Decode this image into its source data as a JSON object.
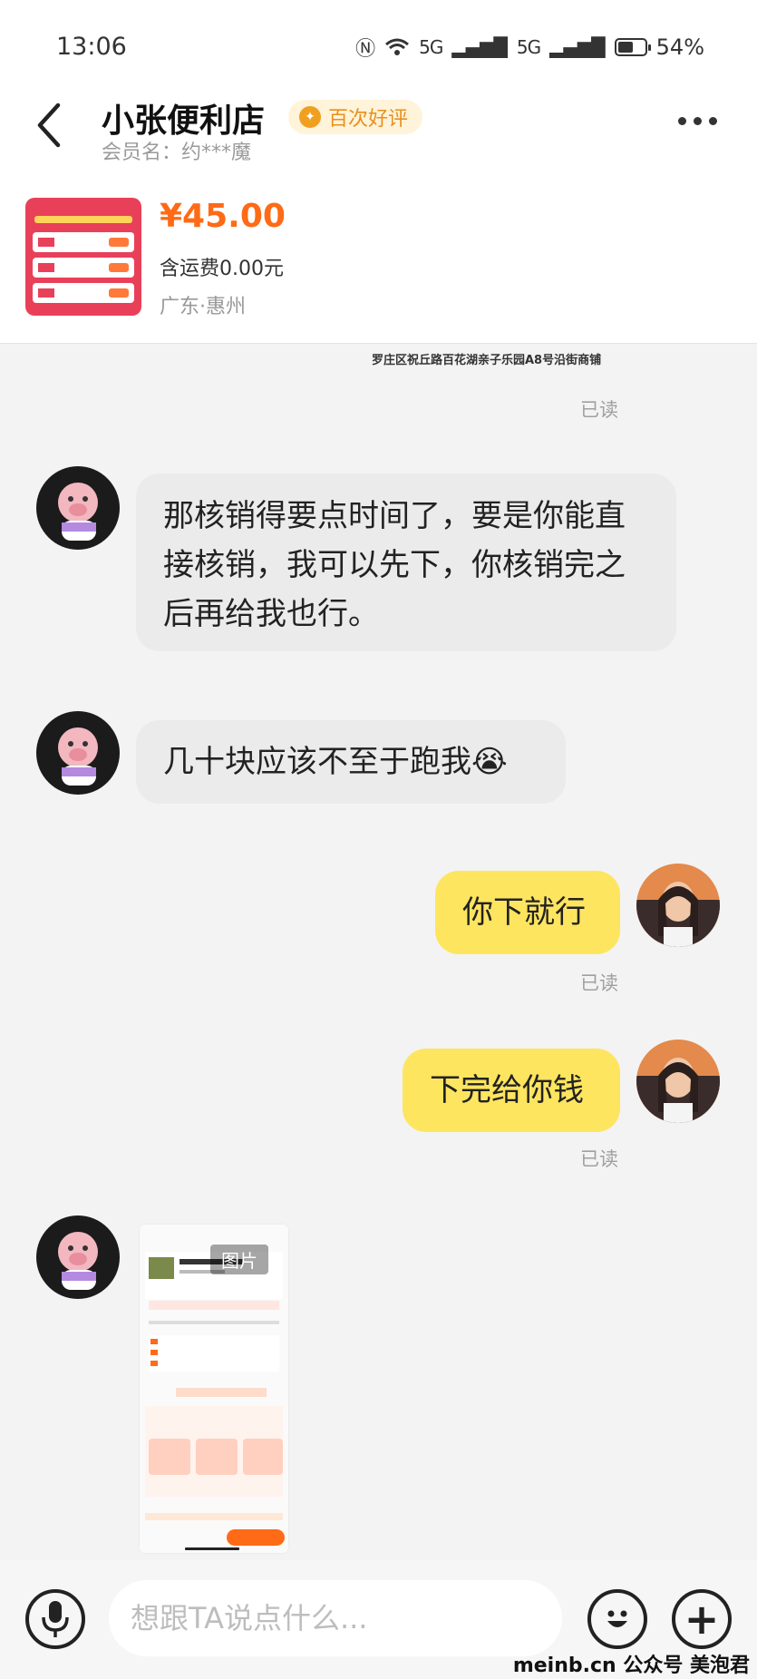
{
  "status_bar": {
    "time": "13:06",
    "net1": "5G",
    "net2": "5G",
    "battery": "54%"
  },
  "header": {
    "shop_name": "小张便利店",
    "badge": "百次好评",
    "member": "会员名：约***魔"
  },
  "product": {
    "price": "¥45.00",
    "shipping": "含运费0.00元",
    "location": "广东·惠州"
  },
  "address_strip": "罗庄区祝丘路百花湖亲子乐园A8号沿街商铺",
  "messages": {
    "read_label": "已读",
    "m1": "那核销得要点时间了，要是你能直接核销，我可以先下，你核销完之后再给我也行。",
    "m2": "几十块应该不至于跑我😭",
    "m3": "你下就行",
    "m4": "下完给你钱",
    "image_tag": "图片"
  },
  "input": {
    "placeholder": "想跟TA说点什么..."
  },
  "watermark": "meinb.cn 公众号 美泡君",
  "colors": {
    "accent": "#ff6a16",
    "self_bubble": "#fde55f",
    "peer_bubble": "#ebebeb"
  }
}
